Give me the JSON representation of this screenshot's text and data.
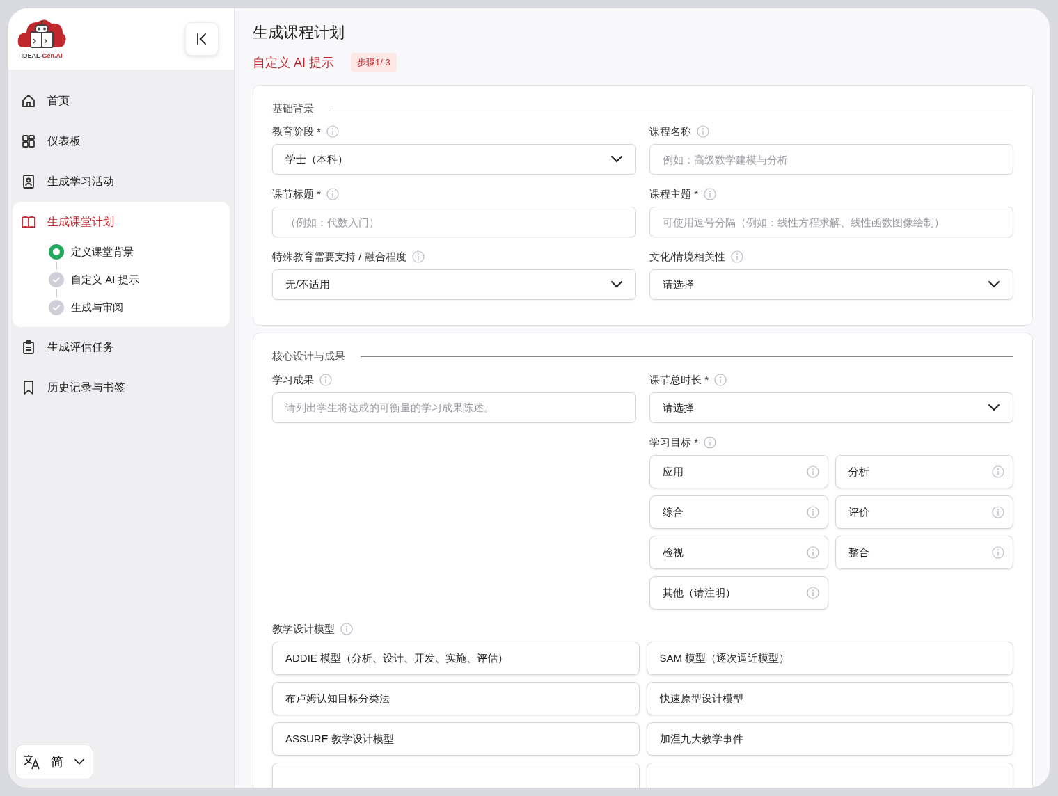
{
  "sidebar": {
    "logo": {
      "text_1": "IDEAL-",
      "text_2": "Gen.AI"
    },
    "items": [
      {
        "label": "首页",
        "selected": false
      },
      {
        "label": "仪表板",
        "selected": false
      },
      {
        "label": "生成学习活动",
        "selected": false
      },
      {
        "label": "生成课堂计划",
        "selected": true,
        "children": [
          {
            "label": "定义课堂背景",
            "current": true
          },
          {
            "label": "自定义 AI 提示",
            "current": false
          },
          {
            "label": "生成与审阅",
            "current": false
          }
        ]
      },
      {
        "label": "生成评估任务",
        "selected": false
      },
      {
        "label": "历史记录与书签",
        "selected": false
      }
    ],
    "language": "简"
  },
  "page": {
    "title": "生成课程计划",
    "subtitle": "自定义 AI 提示",
    "step_badge": "步骤1/ 3"
  },
  "sections": [
    {
      "title": "基础背景",
      "fields": [
        {
          "label": "教育阶段 *",
          "kind": "select",
          "value": "学士（本科）"
        },
        {
          "label": "课程名称",
          "kind": "input",
          "placeholder": "例如：高级数学建模与分析"
        },
        {
          "label": "课节标题 *",
          "kind": "input",
          "placeholder": "（例如：代数入门）"
        },
        {
          "label": "课程主题 *",
          "kind": "input",
          "placeholder": "可使用逗号分隔（例如：线性方程求解、线性函数图像绘制）"
        },
        {
          "label": "特殊教育需要支持 / 融合程度",
          "kind": "select",
          "value": "无/不适用"
        },
        {
          "label": "文化/情境相关性",
          "kind": "select",
          "value": "请选择"
        }
      ]
    },
    {
      "title": "核心设计与成果",
      "fields": [
        {
          "label": "学习成果",
          "kind": "input",
          "placeholder": "请列出学生将达成的可衡量的学习成果陈述。"
        },
        {
          "label": "课节总时长 *",
          "kind": "select",
          "value": "请选择"
        }
      ],
      "objectives": {
        "label": "学习目标 *",
        "options": [
          "应用",
          "分析",
          "综合",
          "评价",
          "检视",
          "整合",
          "其他（请注明）"
        ]
      },
      "models": {
        "label": "教学设计模型",
        "options": [
          "ADDIE 模型（分析、设计、开发、实施、评估）",
          "SAM 模型（逐次逼近模型）",
          "布卢姆认知目标分类法",
          "快速原型设计模型",
          "ASSURE 教学设计模型",
          "加涅九大教学事件"
        ]
      }
    }
  ]
}
